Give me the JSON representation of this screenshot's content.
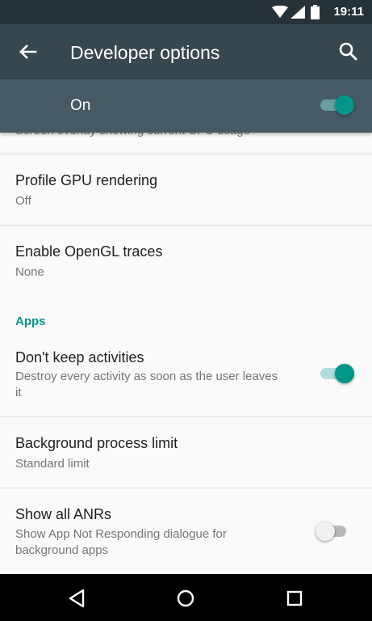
{
  "status_bar": {
    "time": "19:11"
  },
  "app_bar": {
    "title": "Developer options"
  },
  "master_switch": {
    "label": "On",
    "state": "on"
  },
  "partial_row": {
    "subtitle": "Screen overlay showing current CPU usage"
  },
  "settings": {
    "profile_gpu": {
      "title": "Profile GPU rendering",
      "value": "Off"
    },
    "opengl_traces": {
      "title": "Enable OpenGL traces",
      "value": "None"
    },
    "apps_header": "Apps",
    "dont_keep_activities": {
      "title": "Don't keep activities",
      "summary": "Destroy every activity as soon as the user leaves it",
      "state": "on"
    },
    "background_limit": {
      "title": "Background process limit",
      "value": "Standard limit"
    },
    "show_anrs": {
      "title": "Show all ANRs",
      "summary": "Show App Not Responding dialogue for background apps",
      "state": "off"
    }
  },
  "colors": {
    "accent": "#009688",
    "app_bar": "#37474f",
    "status_bar": "#263238",
    "master_bar": "#455a64"
  }
}
